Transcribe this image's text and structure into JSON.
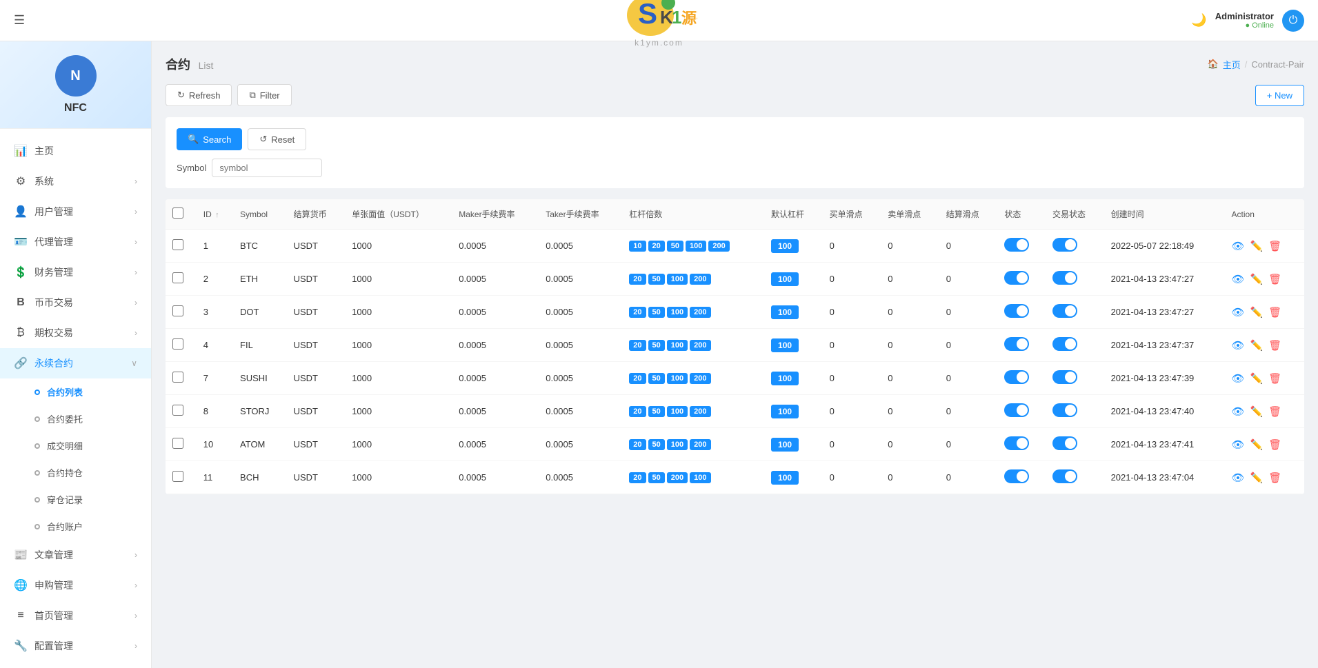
{
  "header": {
    "menu_icon": "☰",
    "logo": {
      "k": "K",
      "one": "1",
      "ym": "源码",
      "domain": "k1ym.com"
    },
    "user": {
      "name": "Administrator",
      "status": "Online"
    },
    "power_label": "⏻"
  },
  "sidebar": {
    "logo_text": "NFC",
    "menu_items": [
      {
        "id": "home",
        "icon": "📊",
        "label": "主页",
        "has_arrow": false
      },
      {
        "id": "system",
        "icon": "⚙",
        "label": "系统",
        "has_arrow": true
      },
      {
        "id": "user-mgmt",
        "icon": "👤",
        "label": "用户管理",
        "has_arrow": true
      },
      {
        "id": "agent-mgmt",
        "icon": "🪪",
        "label": "代理管理",
        "has_arrow": true
      },
      {
        "id": "finance-mgmt",
        "icon": "💲",
        "label": "财务管理",
        "has_arrow": true
      },
      {
        "id": "coin-trade",
        "icon": "B",
        "label": "币币交易",
        "has_arrow": true
      },
      {
        "id": "options-trade",
        "icon": "₿",
        "label": "期权交易",
        "has_arrow": true
      },
      {
        "id": "perpetual",
        "icon": "🔗",
        "label": "永续合约",
        "has_arrow": true,
        "active": true
      },
      {
        "id": "article-mgmt",
        "icon": "📰",
        "label": "文章管理",
        "has_arrow": true
      },
      {
        "id": "apply-mgmt",
        "icon": "🌐",
        "label": "申购管理",
        "has_arrow": true
      },
      {
        "id": "homepage-mgmt",
        "icon": "≡",
        "label": "首页管理",
        "has_arrow": true
      },
      {
        "id": "config-mgmt",
        "icon": "🔧",
        "label": "配置管理",
        "has_arrow": true
      }
    ],
    "submenu_perpetual": [
      {
        "id": "contract-list",
        "label": "合约列表",
        "active": true
      },
      {
        "id": "contract-entrust",
        "label": "合约委托"
      },
      {
        "id": "transaction-detail",
        "label": "成交明细"
      },
      {
        "id": "contract-position",
        "label": "合约持仓"
      },
      {
        "id": "穿仓记录",
        "label": "穿仓记录"
      },
      {
        "id": "contract-account",
        "label": "合约账户"
      }
    ]
  },
  "page": {
    "title": "合约",
    "subtitle": "List",
    "breadcrumb": {
      "home": "主页",
      "current": "Contract-Pair"
    }
  },
  "toolbar": {
    "refresh_label": "Refresh",
    "filter_label": "Filter",
    "new_label": "+ New"
  },
  "search": {
    "search_label": "Search",
    "reset_label": "Reset",
    "symbol_field_label": "Symbol",
    "symbol_placeholder": "symbol"
  },
  "table": {
    "columns": [
      "ID",
      "Symbol",
      "结算货币",
      "单张面值（USDT）",
      "Maker手续费率",
      "Taker手续费率",
      "杠杆倍数",
      "默认杠杆",
      "买单滑点",
      "卖单滑点",
      "结算滑点",
      "状态",
      "交易状态",
      "创建时间",
      "Action"
    ],
    "rows": [
      {
        "id": 1,
        "symbol": "BTC",
        "currency": "USDT",
        "face_value": 1000,
        "maker_fee": "0.0005",
        "taker_fee": "0.0005",
        "leverages": [
          "10",
          "20",
          "50",
          "100",
          "200"
        ],
        "default_lever": "100",
        "buy_slip": 0,
        "sell_slip": 0,
        "settle_slip": 0,
        "status": true,
        "trade_status": true,
        "created_at": "2022-05-07 22:18:49"
      },
      {
        "id": 2,
        "symbol": "ETH",
        "currency": "USDT",
        "face_value": 1000,
        "maker_fee": "0.0005",
        "taker_fee": "0.0005",
        "leverages": [
          "20",
          "50",
          "100",
          "200"
        ],
        "default_lever": "100",
        "buy_slip": 0,
        "sell_slip": 0,
        "settle_slip": 0,
        "status": true,
        "trade_status": true,
        "created_at": "2021-04-13 23:47:27"
      },
      {
        "id": 3,
        "symbol": "DOT",
        "currency": "USDT",
        "face_value": 1000,
        "maker_fee": "0.0005",
        "taker_fee": "0.0005",
        "leverages": [
          "20",
          "50",
          "100",
          "200"
        ],
        "default_lever": "100",
        "buy_slip": 0,
        "sell_slip": 0,
        "settle_slip": 0,
        "status": true,
        "trade_status": true,
        "created_at": "2021-04-13 23:47:27"
      },
      {
        "id": 4,
        "symbol": "FIL",
        "currency": "USDT",
        "face_value": 1000,
        "maker_fee": "0.0005",
        "taker_fee": "0.0005",
        "leverages": [
          "20",
          "50",
          "100",
          "200"
        ],
        "default_lever": "100",
        "buy_slip": 0,
        "sell_slip": 0,
        "settle_slip": 0,
        "status": true,
        "trade_status": true,
        "created_at": "2021-04-13 23:47:37"
      },
      {
        "id": 7,
        "symbol": "SUSHI",
        "currency": "USDT",
        "face_value": 1000,
        "maker_fee": "0.0005",
        "taker_fee": "0.0005",
        "leverages": [
          "20",
          "50",
          "100",
          "200"
        ],
        "default_lever": "100",
        "buy_slip": 0,
        "sell_slip": 0,
        "settle_slip": 0,
        "status": true,
        "trade_status": true,
        "created_at": "2021-04-13 23:47:39"
      },
      {
        "id": 8,
        "symbol": "STORJ",
        "currency": "USDT",
        "face_value": 1000,
        "maker_fee": "0.0005",
        "taker_fee": "0.0005",
        "leverages": [
          "20",
          "50",
          "100",
          "200"
        ],
        "default_lever": "100",
        "buy_slip": 0,
        "sell_slip": 0,
        "settle_slip": 0,
        "status": true,
        "trade_status": true,
        "created_at": "2021-04-13 23:47:40"
      },
      {
        "id": 10,
        "symbol": "ATOM",
        "currency": "USDT",
        "face_value": 1000,
        "maker_fee": "0.0005",
        "taker_fee": "0.0005",
        "leverages": [
          "20",
          "50",
          "100",
          "200"
        ],
        "default_lever": "100",
        "buy_slip": 0,
        "sell_slip": 0,
        "settle_slip": 0,
        "status": true,
        "trade_status": true,
        "created_at": "2021-04-13 23:47:41"
      },
      {
        "id": 11,
        "symbol": "BCH",
        "currency": "USDT",
        "face_value": 1000,
        "maker_fee": "0.0005",
        "taker_fee": "0.0005",
        "leverages": [
          "20",
          "50",
          "200",
          "100"
        ],
        "default_lever": "100",
        "buy_slip": 0,
        "sell_slip": 0,
        "settle_slip": 0,
        "status": true,
        "trade_status": true,
        "created_at": "2021-04-13 23:47:04"
      }
    ]
  },
  "colors": {
    "primary": "#1890ff",
    "success": "#4CAF50",
    "danger": "#ff4d4f",
    "border": "#f0f0f0",
    "bg": "#f0f2f5"
  }
}
